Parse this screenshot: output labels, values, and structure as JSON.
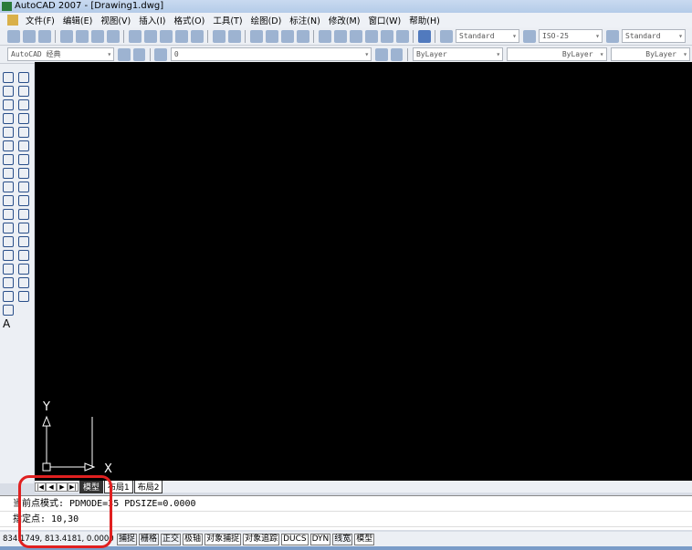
{
  "window": {
    "title": "AutoCAD 2007 - [Drawing1.dwg]"
  },
  "menu": [
    "文件(F)",
    "编辑(E)",
    "视图(V)",
    "插入(I)",
    "格式(O)",
    "工具(T)",
    "绘图(D)",
    "标注(N)",
    "修改(M)",
    "窗口(W)",
    "帮助(H)"
  ],
  "toolbar": {
    "text_style": "Standard",
    "dim_style": "ISO-25",
    "table_style": "Standard",
    "workspace": "AutoCAD 经典",
    "layer": "0",
    "color": "ByLayer",
    "linetype": "ByLayer",
    "lineweight": "ByLayer"
  },
  "ucs": {
    "x_label": "X",
    "y_label": "Y"
  },
  "layout_tabs": [
    "模型",
    "布局1",
    "布局2"
  ],
  "command": {
    "line1": "当前点模式:  PDMODE=35  PDSIZE=0.0000",
    "line2": "指定点: 10,30"
  },
  "status": {
    "coords": "834.1749, 813.4181, 0.0000",
    "buttons": [
      "捕捉",
      "栅格",
      "正交",
      "极轴",
      "对象捕捉",
      "对象追踪",
      "DUCS",
      "DYN",
      "线宽",
      "模型"
    ]
  },
  "colors": {
    "canvas": "#000000",
    "annotation": "#e02020"
  }
}
